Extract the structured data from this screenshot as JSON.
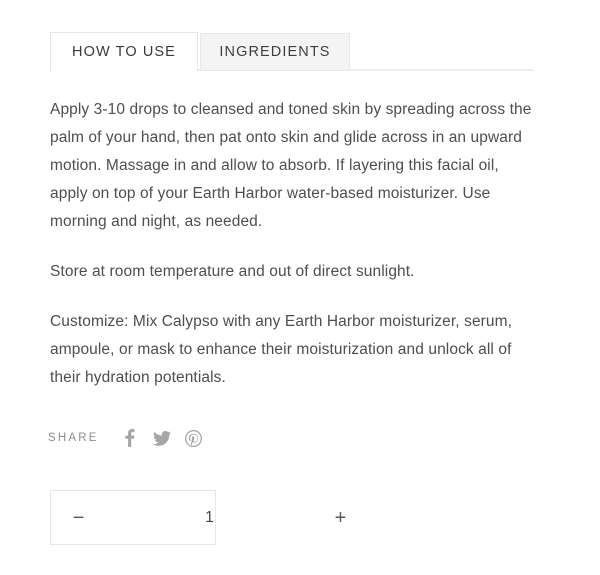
{
  "tabs": [
    {
      "label": "HOW TO USE",
      "active": true
    },
    {
      "label": "INGREDIENTS",
      "active": false
    }
  ],
  "content": {
    "paragraphs": [
      "Apply 3-10 drops to cleansed and toned skin by spreading across the palm of your hand, then pat onto skin and glide across in an upward motion. Massage in and allow to absorb. If layering this facial oil, apply on top of your Earth Harbor water-based moisturizer. Use morning and night, as needed.",
      "Store at room temperature and out of direct sunlight.",
      "Customize: Mix Calypso with any Earth Harbor moisturizer, serum, ampoule, or mask to enhance their moisturization and unlock all of their hydration potentials."
    ]
  },
  "share": {
    "label": "SHARE",
    "icons": [
      {
        "name": "facebook-icon"
      },
      {
        "name": "twitter-icon"
      },
      {
        "name": "pinterest-icon"
      }
    ]
  },
  "quantity": {
    "decrement_label": "−",
    "value": "1",
    "increment_label": "+"
  },
  "colors": {
    "text": "#4e4e4e",
    "muted": "#8d8d8d",
    "border": "#e8e8e8",
    "inactive_tab_bg": "#f4f4f4",
    "icon": "#a6a6a6"
  }
}
